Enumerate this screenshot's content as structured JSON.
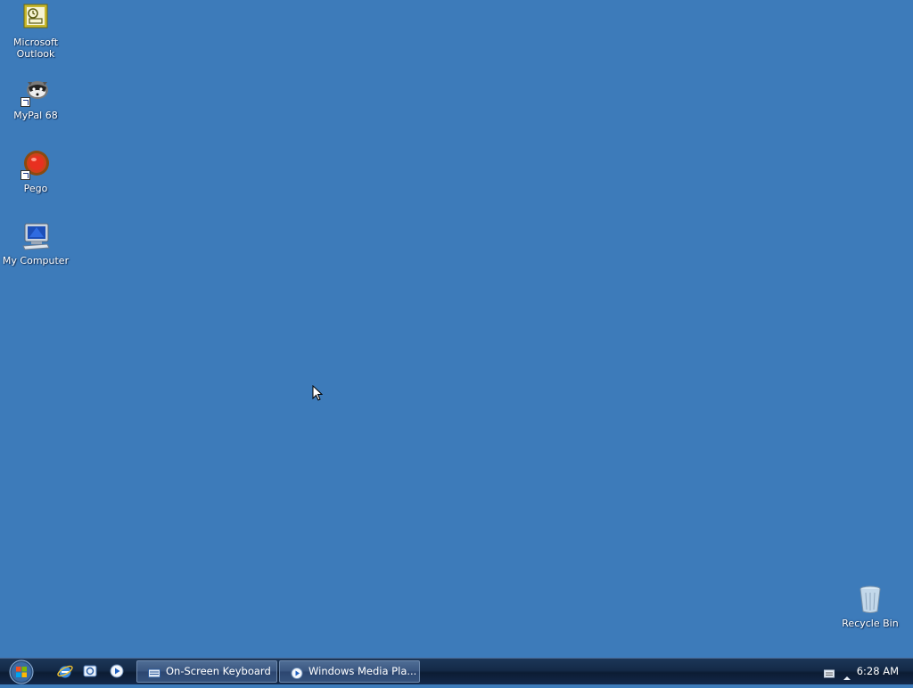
{
  "desktop": {
    "background_color": "#3d7bba",
    "icons": [
      {
        "label": "Microsoft\nOutlook",
        "icon": "outlook-icon"
      },
      {
        "label": "MyPal 68",
        "icon": "mypal-raccoon-icon"
      },
      {
        "label": "Pego",
        "icon": "pego-icon"
      },
      {
        "label": "My Computer",
        "icon": "computer-icon"
      },
      {
        "label": "Recycle Bin",
        "icon": "recycle-bin-icon"
      }
    ]
  },
  "taskbar": {
    "start_button": "start-orb",
    "quick_launch": [
      {
        "icon": "internet-explorer-icon"
      },
      {
        "icon": "email-icon"
      },
      {
        "icon": "media-player-icon"
      }
    ],
    "tasks": [
      {
        "label": "On-Screen Keyboard",
        "icon": "keyboard-icon"
      },
      {
        "label": "Windows Media Pla...",
        "icon": "media-player-icon"
      }
    ],
    "clock": "6:28 AM"
  }
}
